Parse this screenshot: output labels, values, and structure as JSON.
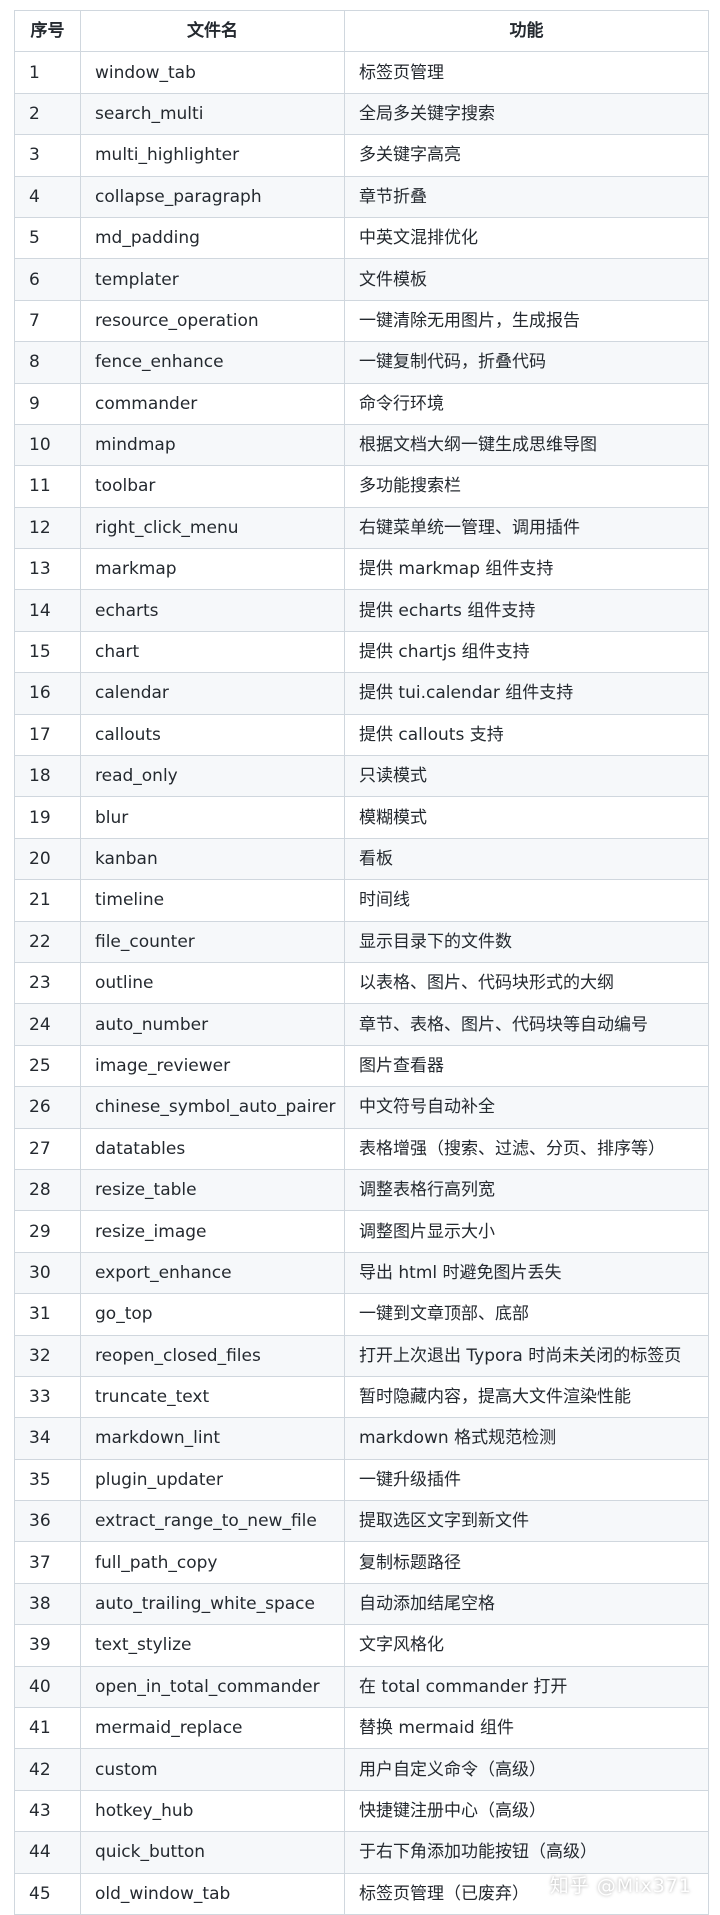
{
  "table": {
    "headers": [
      "序号",
      "文件名",
      "功能"
    ],
    "rows": [
      [
        "1",
        "window_tab",
        "标签页管理"
      ],
      [
        "2",
        "search_multi",
        "全局多关键字搜索"
      ],
      [
        "3",
        "multi_highlighter",
        "多关键字高亮"
      ],
      [
        "4",
        "collapse_paragraph",
        "章节折叠"
      ],
      [
        "5",
        "md_padding",
        "中英文混排优化"
      ],
      [
        "6",
        "templater",
        "文件模板"
      ],
      [
        "7",
        "resource_operation",
        "一键清除无用图片，生成报告"
      ],
      [
        "8",
        "fence_enhance",
        "一键复制代码，折叠代码"
      ],
      [
        "9",
        "commander",
        "命令行环境"
      ],
      [
        "10",
        "mindmap",
        "根据文档大纲一键生成思维导图"
      ],
      [
        "11",
        "toolbar",
        "多功能搜索栏"
      ],
      [
        "12",
        "right_click_menu",
        "右键菜单统一管理、调用插件"
      ],
      [
        "13",
        "markmap",
        "提供 markmap 组件支持"
      ],
      [
        "14",
        "echarts",
        "提供 echarts 组件支持"
      ],
      [
        "15",
        "chart",
        "提供 chartjs 组件支持"
      ],
      [
        "16",
        "calendar",
        "提供 tui.calendar 组件支持"
      ],
      [
        "17",
        "callouts",
        "提供 callouts 支持"
      ],
      [
        "18",
        "read_only",
        "只读模式"
      ],
      [
        "19",
        "blur",
        "模糊模式"
      ],
      [
        "20",
        "kanban",
        "看板"
      ],
      [
        "21",
        "timeline",
        "时间线"
      ],
      [
        "22",
        "file_counter",
        "显示目录下的文件数"
      ],
      [
        "23",
        "outline",
        "以表格、图片、代码块形式的大纲"
      ],
      [
        "24",
        "auto_number",
        "章节、表格、图片、代码块等自动编号"
      ],
      [
        "25",
        "image_reviewer",
        "图片查看器"
      ],
      [
        "26",
        "chinese_symbol_auto_pairer",
        "中文符号自动补全"
      ],
      [
        "27",
        "datatables",
        "表格增强（搜索、过滤、分页、排序等）"
      ],
      [
        "28",
        "resize_table",
        "调整表格行高列宽"
      ],
      [
        "29",
        "resize_image",
        "调整图片显示大小"
      ],
      [
        "30",
        "export_enhance",
        "导出 html 时避免图片丢失"
      ],
      [
        "31",
        "go_top",
        "一键到文章顶部、底部"
      ],
      [
        "32",
        "reopen_closed_files",
        "打开上次退出 Typora 时尚未关闭的标签页"
      ],
      [
        "33",
        "truncate_text",
        "暂时隐藏内容，提高大文件渲染性能"
      ],
      [
        "34",
        "markdown_lint",
        "markdown 格式规范检测"
      ],
      [
        "35",
        "plugin_updater",
        "一键升级插件"
      ],
      [
        "36",
        "extract_range_to_new_file",
        "提取选区文字到新文件"
      ],
      [
        "37",
        "full_path_copy",
        "复制标题路径"
      ],
      [
        "38",
        "auto_trailing_white_space",
        "自动添加结尾空格"
      ],
      [
        "39",
        "text_stylize",
        "文字风格化"
      ],
      [
        "40",
        "open_in_total_commander",
        "在 total commander 打开"
      ],
      [
        "41",
        "mermaid_replace",
        "替换 mermaid 组件"
      ],
      [
        "42",
        "custom",
        "用户自定义命令（高级）"
      ],
      [
        "43",
        "hotkey_hub",
        "快捷键注册中心（高级）"
      ],
      [
        "44",
        "quick_button",
        "于右下角添加功能按钮（高级）"
      ],
      [
        "45",
        "old_window_tab",
        "标签页管理（已废弃）"
      ]
    ]
  },
  "watermark": "知乎 @Mix371",
  "colors": {
    "border": "#d0d7de",
    "stripe": "#f6f8fa",
    "text": "#24292f"
  }
}
